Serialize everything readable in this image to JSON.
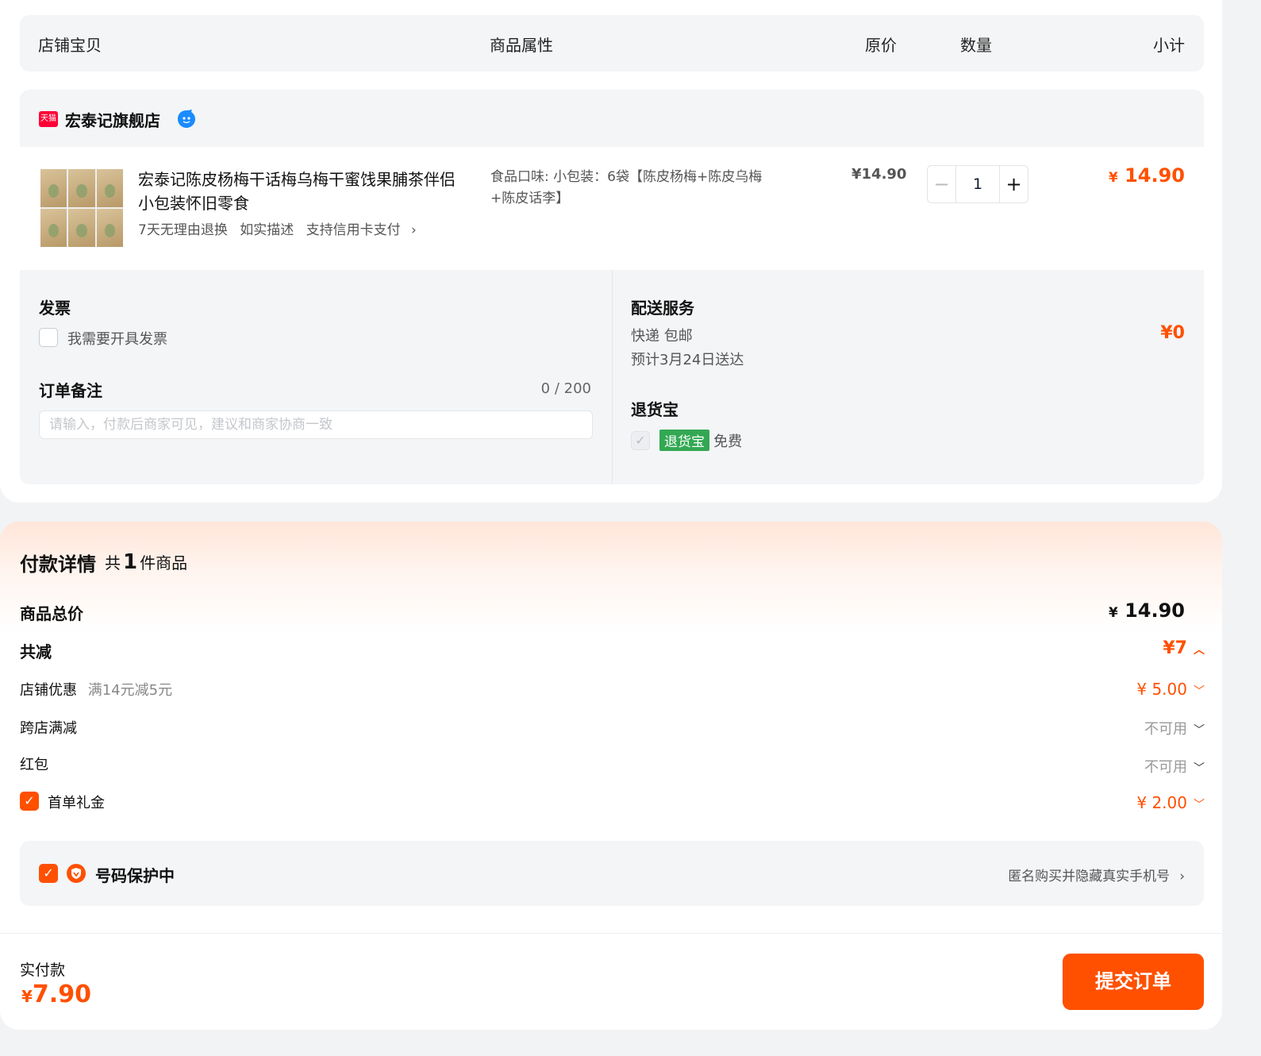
{
  "table_header": {
    "col_item": "店铺宝贝",
    "col_attr": "商品属性",
    "col_price": "原价",
    "col_qty": "数量",
    "col_subtotal": "小计"
  },
  "shop": {
    "badge": "天猫",
    "name": "宏泰记旗舰店"
  },
  "item": {
    "title": "宏泰记陈皮杨梅干话梅乌梅干蜜饯果脯茶伴侣小包装怀旧零食",
    "tags": [
      "7天无理由退换",
      "如实描述",
      "支持信用卡支付"
    ],
    "attr": "食品口味: 小包装：6袋【陈皮杨梅+陈皮乌梅+陈皮话李】",
    "price": "¥14.90",
    "qty_value": "1",
    "minus": "−",
    "plus": "+",
    "subtotal_yen": "¥",
    "subtotal": "14.90"
  },
  "invoice": {
    "title": "发票",
    "checkbox_label": "我需要开具发票"
  },
  "note": {
    "title": "订单备注",
    "counter": "0 / 200",
    "placeholder": "请输入，付款后商家可见，建议和商家协商一致"
  },
  "delivery": {
    "title": "配送服务",
    "method": "快递 包邮",
    "eta": "预计3月24日送达",
    "fee": "¥0"
  },
  "return_insurance": {
    "title": "退货宝",
    "badge": "退货宝",
    "label": "免费"
  },
  "payment": {
    "title": "付款详情",
    "count_prefix": "共",
    "count": "1",
    "count_suffix": "件商品",
    "total_label": "商品总价",
    "total_yen": "¥",
    "total_value": "14.90",
    "discount_label": "共减",
    "discount_value": "¥7",
    "shop_coupon_label": "店铺优惠",
    "shop_coupon_desc": "满14元减5元",
    "shop_coupon_value": "¥ 5.00",
    "cross_label": "跨店满减",
    "cross_value": "不可用",
    "redpacket_label": "红包",
    "redpacket_value": "不可用",
    "firstorder_label": "首单礼金",
    "firstorder_value": "¥ 2.00"
  },
  "protect": {
    "label": "号码保护中",
    "desc": "匿名购买并隐藏真实手机号"
  },
  "footer": {
    "paid_label": "实付款",
    "paid_yen": "¥",
    "paid_value": "7.90",
    "submit": "提交订单"
  },
  "colors": {
    "accent": "#ff5000",
    "green": "#33a853",
    "tmall": "#ff0036"
  }
}
